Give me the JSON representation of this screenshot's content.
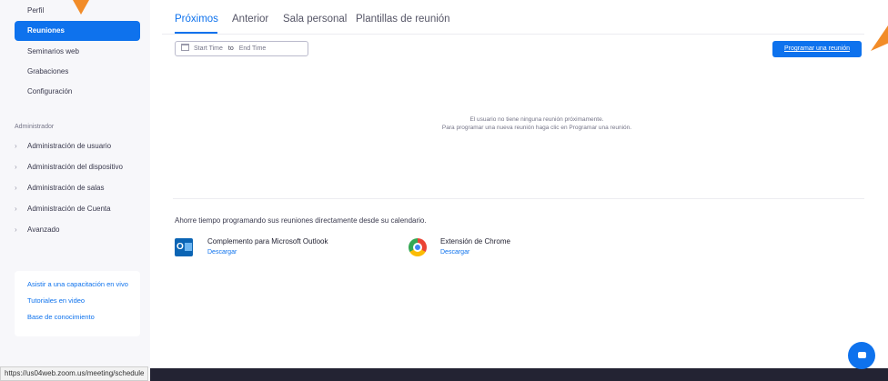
{
  "sidebar": {
    "items": [
      {
        "label": "Perfil"
      },
      {
        "label": "Reuniones"
      },
      {
        "label": "Seminarios web"
      },
      {
        "label": "Grabaciones"
      },
      {
        "label": "Configuración"
      }
    ],
    "admin_heading": "Administrador",
    "admin_items": [
      {
        "label": "Administración de usuario"
      },
      {
        "label": "Administración del dispositivo"
      },
      {
        "label": "Administración de salas"
      },
      {
        "label": "Administración de Cuenta"
      },
      {
        "label": "Avanzado"
      }
    ],
    "help_links": [
      {
        "label": "Asistir a una capacitación en vivo"
      },
      {
        "label": "Tutoriales en video"
      },
      {
        "label": "Base de conocimiento"
      }
    ]
  },
  "tabs": [
    {
      "label": "Próximos"
    },
    {
      "label": "Anterior"
    },
    {
      "label": "Sala personal"
    },
    {
      "label": "Plantillas de reunión"
    }
  ],
  "date_filter": {
    "start": "Start Time",
    "to": "to",
    "end": "End Time"
  },
  "schedule_button": "Programar una reunión",
  "empty_state": {
    "line1": "El usuario no tiene ninguna reunión próximamente.",
    "line2": "Para programar una nueva reunión haga clic en Programar una reunión."
  },
  "promo": {
    "title": "Ahorre tiempo programando sus reuniones directamente desde su calendario.",
    "plugins": [
      {
        "name": "Complemento para Microsoft Outlook",
        "link": "Descargar",
        "icon": "outlook-icon"
      },
      {
        "name": "Extensión de Chrome",
        "link": "Descargar",
        "icon": "chrome-icon"
      }
    ]
  },
  "status_url": "https://us04web.zoom.us/meeting/schedule",
  "colors": {
    "accent": "#0e72ed",
    "arrow": "#f28c28",
    "sidebar_bg": "#f7f7fa",
    "footer": "#232333"
  }
}
